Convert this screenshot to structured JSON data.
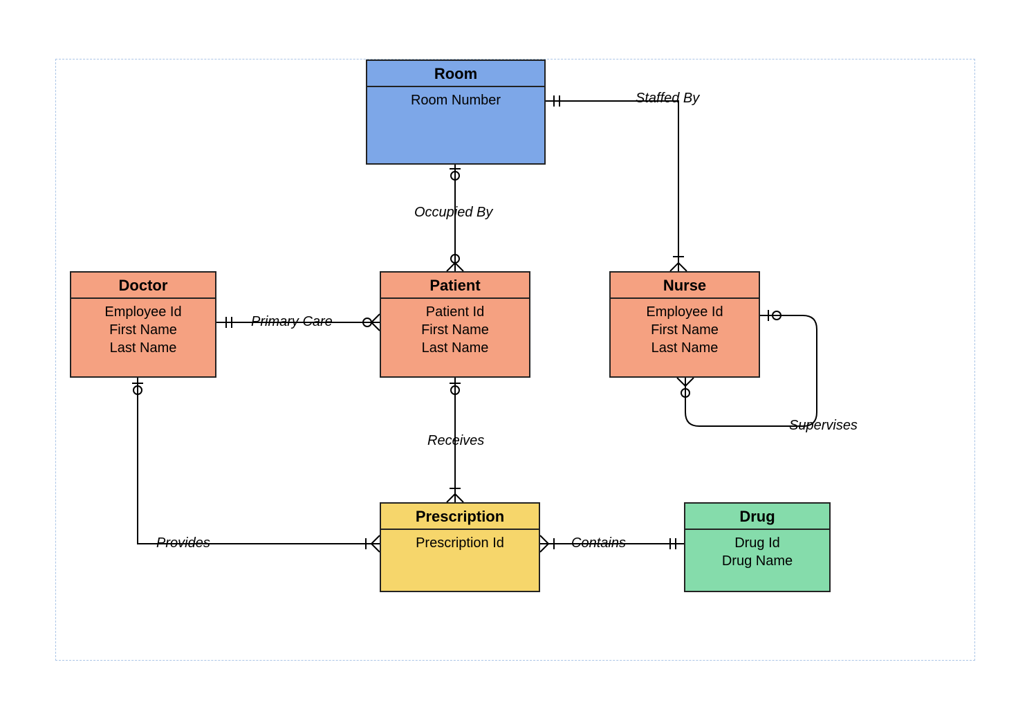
{
  "entities": {
    "room": {
      "title": "Room",
      "attrs": [
        "Room Number"
      ]
    },
    "doctor": {
      "title": "Doctor",
      "attrs": [
        "Employee Id",
        "First Name",
        "Last Name"
      ]
    },
    "patient": {
      "title": "Patient",
      "attrs": [
        "Patient Id",
        "First Name",
        "Last Name"
      ]
    },
    "nurse": {
      "title": "Nurse",
      "attrs": [
        "Employee Id",
        "First Name",
        "Last Name"
      ]
    },
    "prescription": {
      "title": "Prescription",
      "attrs": [
        "Prescription Id"
      ]
    },
    "drug": {
      "title": "Drug",
      "attrs": [
        "Drug Id",
        "Drug Name"
      ]
    }
  },
  "relationships": {
    "staffed_by": {
      "label": "Staffed By"
    },
    "occupied_by": {
      "label": "Occupied By"
    },
    "primary_care": {
      "label": "Primary Care"
    },
    "receives": {
      "label": "Receives"
    },
    "provides": {
      "label": "Provides"
    },
    "contains": {
      "label": "Contains"
    },
    "supervises": {
      "label": "Supervises"
    }
  },
  "colors": {
    "room": "#7da7e8",
    "person": "#f5a181",
    "prescription": "#f6d66b",
    "drug": "#85dcab"
  }
}
